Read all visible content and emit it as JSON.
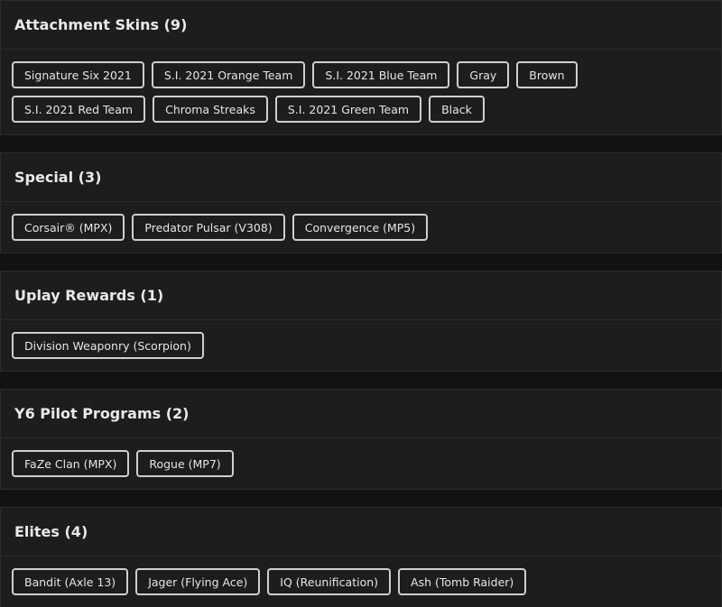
{
  "sections": [
    {
      "title": "Attachment Skins (9)",
      "chips": [
        "Signature Six 2021",
        "S.I. 2021 Orange Team",
        "S.I. 2021 Blue Team",
        "Gray",
        "Brown",
        "S.I. 2021 Red Team",
        "Chroma Streaks",
        "S.I. 2021 Green Team",
        "Black"
      ]
    },
    {
      "title": "Special (3)",
      "chips": [
        "Corsair® (MPX)",
        "Predator Pulsar (V308)",
        "Convergence (MP5)"
      ]
    },
    {
      "title": "Uplay Rewards (1)",
      "chips": [
        "Division Weaponry (Scorpion)"
      ]
    },
    {
      "title": "Y6 Pilot Programs (2)",
      "chips": [
        "FaZe Clan (MPX)",
        "Rogue (MP7)"
      ]
    },
    {
      "title": "Elites (4)",
      "chips": [
        "Bandit (Axle 13)",
        "Jager (Flying Ace)",
        "IQ (Reunification)",
        "Ash (Tomb Raider)"
      ]
    }
  ]
}
